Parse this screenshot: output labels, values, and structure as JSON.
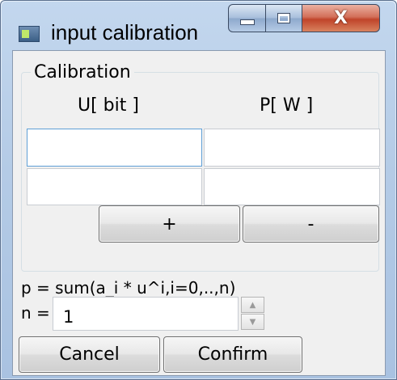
{
  "window": {
    "title": "input calibration",
    "controls": {
      "minimize": "minimize",
      "maximize": "maximize",
      "close_label": "X"
    }
  },
  "calibration": {
    "group_title": "Calibration",
    "columns": [
      "U[ bit ]",
      "P[ W ]"
    ],
    "rows": [
      {
        "u": "",
        "p": ""
      },
      {
        "u": "",
        "p": ""
      }
    ],
    "add_label": "+",
    "remove_label": "-"
  },
  "polynomial": {
    "formula": "p = sum(a_i * u^i,i=0,..,n)",
    "n_label": "n =",
    "n_value": "1",
    "spin_up": "▲",
    "spin_down": "▼"
  },
  "footer": {
    "cancel_label": "Cancel",
    "confirm_label": "Confirm"
  }
}
